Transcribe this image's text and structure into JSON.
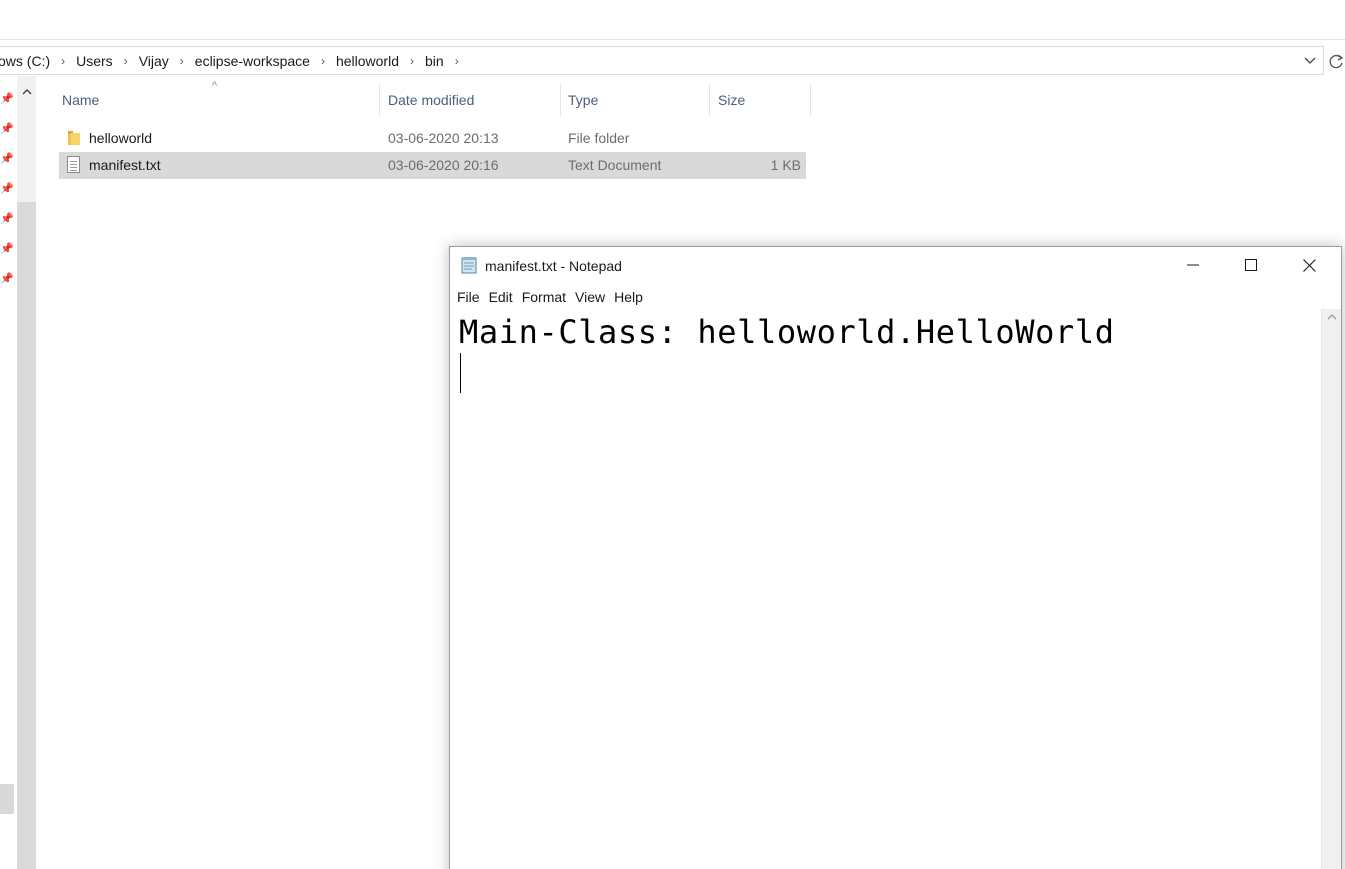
{
  "explorer": {
    "breadcrumbs": [
      "ows (C:)",
      "Users",
      "Vijay",
      "eclipse-workspace",
      "helloworld",
      "bin"
    ],
    "columns": {
      "name": "Name",
      "date": "Date modified",
      "type": "Type",
      "size": "Size"
    },
    "rows": [
      {
        "name": "helloworld",
        "date": "03-06-2020 20:13",
        "type": "File folder",
        "size": "",
        "icon": "folder-icon",
        "selected": false
      },
      {
        "name": "manifest.txt",
        "date": "03-06-2020 20:16",
        "type": "Text Document",
        "size": "1 KB",
        "icon": "text-file-icon",
        "selected": true
      }
    ]
  },
  "notepad": {
    "title": "manifest.txt - Notepad",
    "menu": [
      "File",
      "Edit",
      "Format",
      "View",
      "Help"
    ],
    "content": "Main-Class: helloworld.HelloWorld"
  },
  "colors": {
    "selection": "#d9d9d9",
    "header_text": "#4c607a",
    "folder": "#f2c04e"
  }
}
